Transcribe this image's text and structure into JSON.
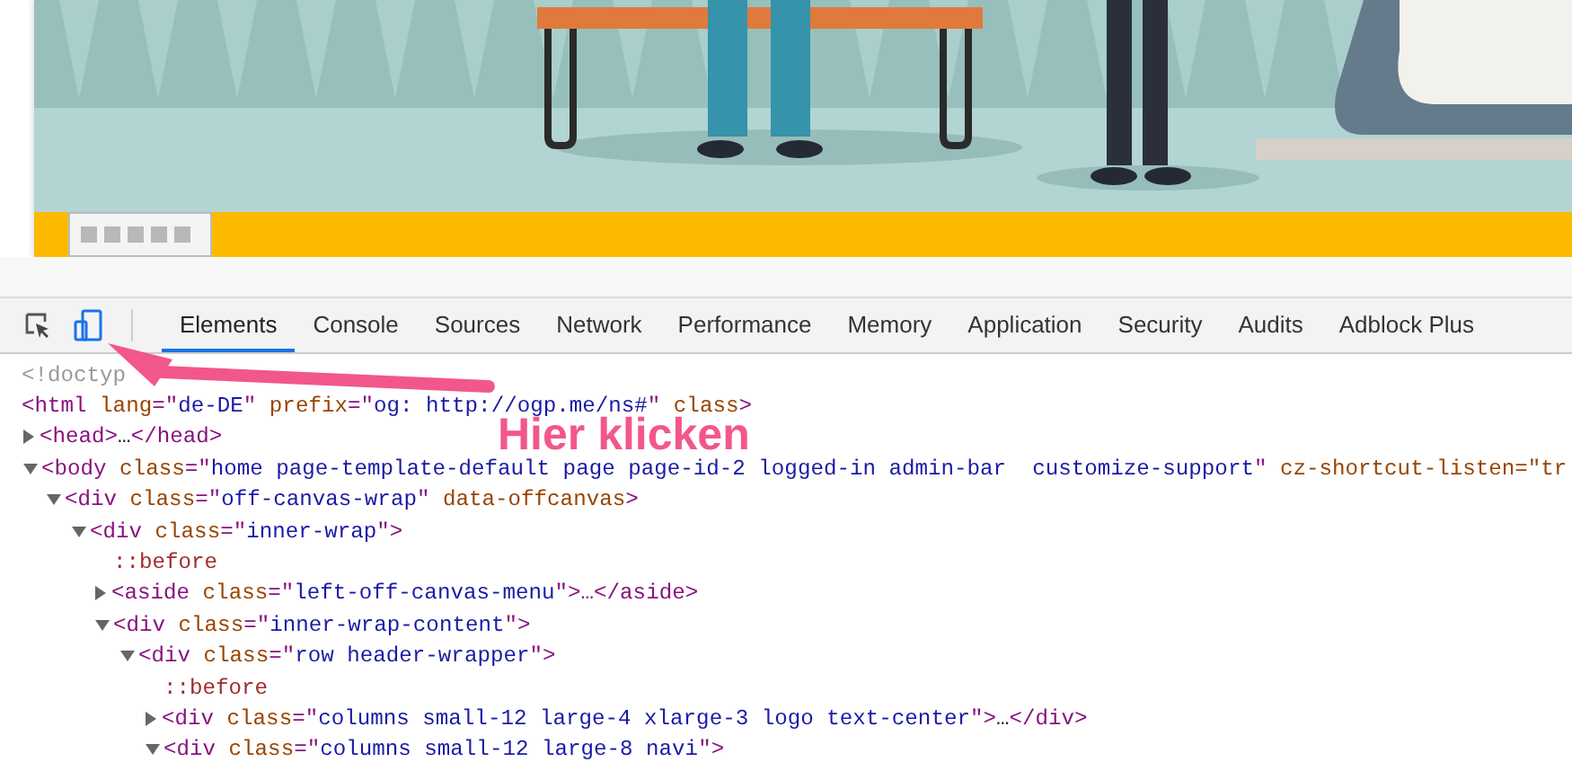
{
  "devtools": {
    "tabs": [
      {
        "label": "Elements",
        "selected": true
      },
      {
        "label": "Console",
        "selected": false
      },
      {
        "label": "Sources",
        "selected": false
      },
      {
        "label": "Network",
        "selected": false
      },
      {
        "label": "Performance",
        "selected": false
      },
      {
        "label": "Memory",
        "selected": false
      },
      {
        "label": "Application",
        "selected": false
      },
      {
        "label": "Security",
        "selected": false
      },
      {
        "label": "Audits",
        "selected": false
      },
      {
        "label": "Adblock Plus",
        "selected": false
      }
    ],
    "device_toolbar_on": true,
    "dom_tree": [
      {
        "tokens": [
          {
            "text": "<!doctyp",
            "kind": "comment"
          }
        ]
      },
      {
        "tokens": [
          {
            "text": "<html",
            "kind": "tag"
          },
          {
            "text": " lang",
            "kind": "attr"
          },
          {
            "text": "=\"",
            "kind": "tag"
          },
          {
            "text": "de-DE",
            "kind": "value"
          },
          {
            "text": "\"",
            "kind": "tag"
          },
          {
            "text": " prefix",
            "kind": "attr"
          },
          {
            "text": "=\"",
            "kind": "tag"
          },
          {
            "text": "og: http://ogp.me/ns#",
            "kind": "value"
          },
          {
            "text": "\"",
            "kind": "tag"
          },
          {
            "text": " class",
            "kind": "attr"
          },
          {
            "text": ">",
            "kind": "tag"
          }
        ],
        "children": [
          {
            "expanded": false,
            "tokens": [
              {
                "text": "<head>",
                "kind": "tag"
              },
              {
                "text": "…",
                "kind": "text"
              },
              {
                "text": "</head>",
                "kind": "tag"
              }
            ]
          },
          {
            "expanded": true,
            "tokens": [
              {
                "text": "<body",
                "kind": "tag"
              },
              {
                "text": " class",
                "kind": "attr"
              },
              {
                "text": "=\"",
                "kind": "tag"
              },
              {
                "text": "home page-template-default page page-id-2 logged-in admin-bar  customize-support",
                "kind": "value"
              },
              {
                "text": "\"",
                "kind": "tag"
              },
              {
                "text": " cz-shortcut-listen",
                "kind": "attr"
              },
              {
                "text": "=\"tr",
                "kind": "attr"
              }
            ],
            "children": [
              {
                "expanded": true,
                "tokens": [
                  {
                    "text": "<div",
                    "kind": "tag"
                  },
                  {
                    "text": " class",
                    "kind": "attr"
                  },
                  {
                    "text": "=\"",
                    "kind": "tag"
                  },
                  {
                    "text": "off-canvas-wrap",
                    "kind": "value"
                  },
                  {
                    "text": "\"",
                    "kind": "tag"
                  },
                  {
                    "text": " data-offcanvas",
                    "kind": "attr"
                  },
                  {
                    "text": ">",
                    "kind": "tag"
                  }
                ],
                "children": [
                  {
                    "expanded": true,
                    "tokens": [
                      {
                        "text": "<div",
                        "kind": "tag"
                      },
                      {
                        "text": " class",
                        "kind": "attr"
                      },
                      {
                        "text": "=\"",
                        "kind": "tag"
                      },
                      {
                        "text": "inner-wrap",
                        "kind": "value"
                      },
                      {
                        "text": "\">",
                        "kind": "tag"
                      }
                    ],
                    "children": [
                      {
                        "tokens": [
                          {
                            "text": "::before",
                            "kind": "pseudo"
                          }
                        ]
                      },
                      {
                        "expanded": false,
                        "tokens": [
                          {
                            "text": "<aside",
                            "kind": "tag"
                          },
                          {
                            "text": " class",
                            "kind": "attr"
                          },
                          {
                            "text": "=\"",
                            "kind": "tag"
                          },
                          {
                            "text": "left-off-canvas-menu",
                            "kind": "value"
                          },
                          {
                            "text": "\">",
                            "kind": "tag"
                          },
                          {
                            "text": "…</aside>",
                            "kind": "tag"
                          }
                        ]
                      },
                      {
                        "expanded": true,
                        "tokens": [
                          {
                            "text": "<div",
                            "kind": "tag"
                          },
                          {
                            "text": " class",
                            "kind": "attr"
                          },
                          {
                            "text": "=\"",
                            "kind": "tag"
                          },
                          {
                            "text": "inner-wrap-content",
                            "kind": "value"
                          },
                          {
                            "text": "\">",
                            "kind": "tag"
                          }
                        ],
                        "children": [
                          {
                            "expanded": true,
                            "tokens": [
                              {
                                "text": "<div",
                                "kind": "tag"
                              },
                              {
                                "text": " class",
                                "kind": "attr"
                              },
                              {
                                "text": "=\"",
                                "kind": "tag"
                              },
                              {
                                "text": "row header-wrapper",
                                "kind": "value"
                              },
                              {
                                "text": "\">",
                                "kind": "tag"
                              }
                            ],
                            "children": [
                              {
                                "tokens": [
                                  {
                                    "text": "::before",
                                    "kind": "pseudo"
                                  }
                                ]
                              },
                              {
                                "expanded": false,
                                "tokens": [
                                  {
                                    "text": "<div",
                                    "kind": "tag"
                                  },
                                  {
                                    "text": " class",
                                    "kind": "attr"
                                  },
                                  {
                                    "text": "=\"",
                                    "kind": "tag"
                                  },
                                  {
                                    "text": "columns small-12 large-4 xlarge-3 logo text-center",
                                    "kind": "value"
                                  },
                                  {
                                    "text": "\">",
                                    "kind": "tag"
                                  },
                                  {
                                    "text": "…",
                                    "kind": "text"
                                  },
                                  {
                                    "text": "</div>",
                                    "kind": "tag"
                                  }
                                ]
                              },
                              {
                                "expanded": true,
                                "tokens": [
                                  {
                                    "text": "<div",
                                    "kind": "tag"
                                  },
                                  {
                                    "text": " class",
                                    "kind": "attr"
                                  },
                                  {
                                    "text": "=\"",
                                    "kind": "tag"
                                  },
                                  {
                                    "text": "columns small-12 large-8 navi",
                                    "kind": "value"
                                  },
                                  {
                                    "text": "\">",
                                    "kind": "tag"
                                  }
                                ]
                              }
                            ]
                          }
                        ]
                      }
                    ]
                  }
                ]
              }
            ]
          }
        ]
      }
    ]
  },
  "annotation": {
    "label": "Hier klicken"
  }
}
